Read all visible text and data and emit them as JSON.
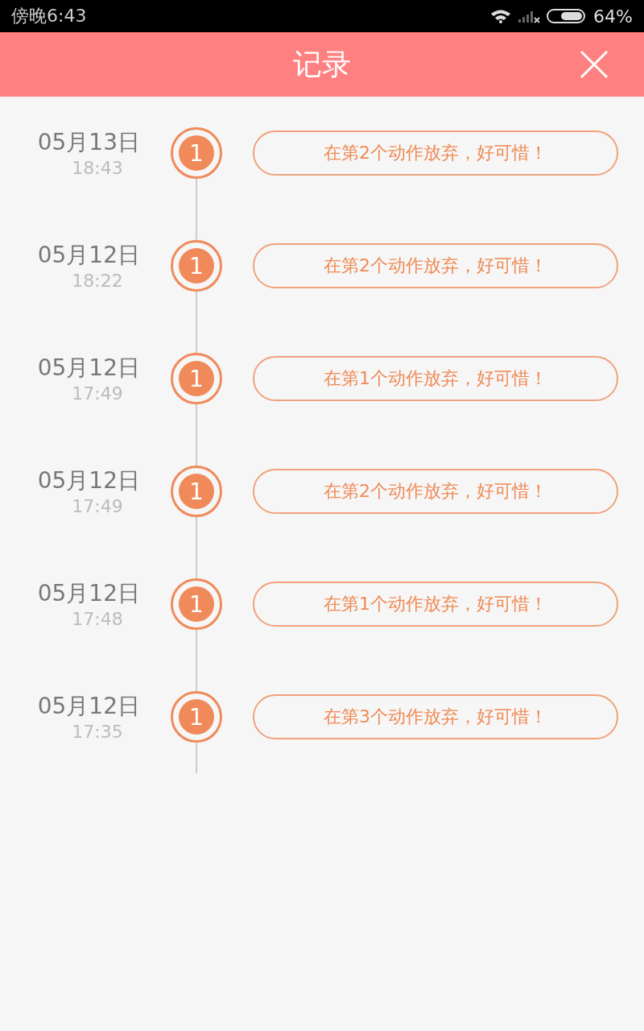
{
  "status_bar": {
    "time": "傍晚6:43",
    "battery": "64%"
  },
  "header": {
    "title": "记录"
  },
  "records": [
    {
      "date": "05月13日",
      "time": "18:43",
      "badge": "1",
      "message": "在第2个动作放弃，好可惜！"
    },
    {
      "date": "05月12日",
      "time": "18:22",
      "badge": "1",
      "message": "在第2个动作放弃，好可惜！"
    },
    {
      "date": "05月12日",
      "time": "17:49",
      "badge": "1",
      "message": "在第1个动作放弃，好可惜！"
    },
    {
      "date": "05月12日",
      "time": "17:49",
      "badge": "1",
      "message": "在第2个动作放弃，好可惜！"
    },
    {
      "date": "05月12日",
      "time": "17:48",
      "badge": "1",
      "message": "在第1个动作放弃，好可惜！"
    },
    {
      "date": "05月12日",
      "time": "17:35",
      "badge": "1",
      "message": "在第3个动作放弃，好可惜！"
    }
  ]
}
